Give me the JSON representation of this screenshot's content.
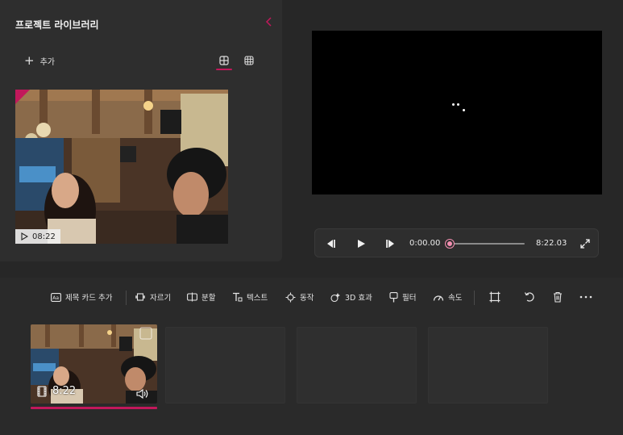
{
  "library": {
    "title": "프로젝트 라이브러리",
    "add_label": "추가",
    "thumbnail_duration": "08:22"
  },
  "player": {
    "current_time": "0:00.00",
    "total_time": "8:22.03",
    "progress": 0.0
  },
  "toolbar": {
    "title_card": "제목 카드 추가",
    "trim": "자르기",
    "split": "분할",
    "text": "텍스트",
    "motion": "동작",
    "effects_3d": "3D 효과",
    "filters": "필터",
    "speed": "속도"
  },
  "timeline": {
    "clip_duration": "8:22",
    "empty_slots": 3
  },
  "colors": {
    "accent": "#c2185b",
    "knob": "#f48fb1",
    "background": "#272727",
    "panel": "#2e2e2e"
  }
}
